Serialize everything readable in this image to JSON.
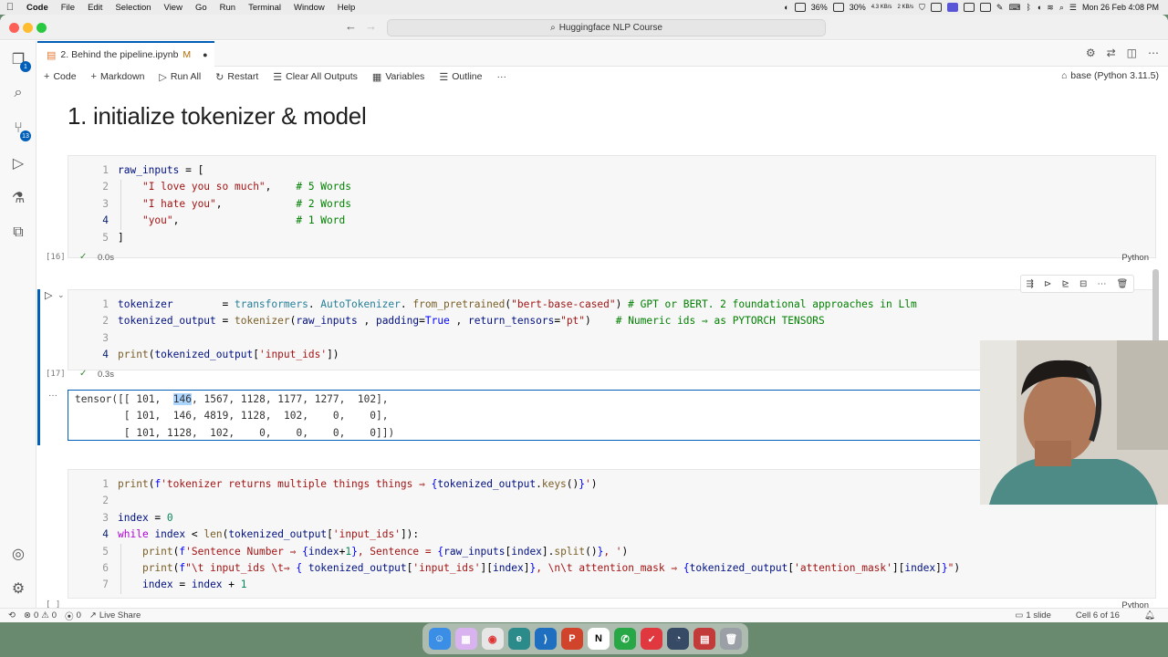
{
  "menubar": {
    "apple": "",
    "items": [
      "Code",
      "File",
      "Edit",
      "Selection",
      "View",
      "Go",
      "Run",
      "Terminal",
      "Window",
      "Help"
    ],
    "battery_pct": "36%",
    "cpu_pct": "30%",
    "net_up": "4.3 KB/s",
    "net_down": "2 KB/s",
    "datetime": "Mon 26 Feb  4:08 PM"
  },
  "titlebar": {
    "search": "Huggingface NLP Course"
  },
  "activity": {
    "explorer_badge": "1",
    "scm_badge": "13"
  },
  "tab": {
    "label": "2. Behind the pipeline.ipynb",
    "modified": "M"
  },
  "toolbar": {
    "code": "Code",
    "markdown": "Markdown",
    "run_all": "Run All",
    "restart": "Restart",
    "clear": "Clear All Outputs",
    "variables": "Variables",
    "outline": "Outline",
    "more": "···",
    "kernel": "base (Python 3.11.5)"
  },
  "heading": "1. initialize tokenizer & model",
  "cells": {
    "c1": {
      "count": "[16]",
      "time": "0.0s",
      "lang": "Python",
      "line_numbers": [
        "1",
        "2",
        "3",
        "4",
        "5"
      ]
    },
    "c2": {
      "count": "[17]",
      "time": "0.3s",
      "line_numbers": [
        "1",
        "2",
        "3",
        "4"
      ]
    },
    "c3": {
      "count": "[ ]",
      "lang": "Python",
      "line_numbers": [
        "1",
        "2",
        "3",
        "4",
        "5",
        "6",
        "7"
      ]
    }
  },
  "output": {
    "text": "tensor([[ 101,  146, 1567, 1128, 1177, 1277,  102],\n        [ 101,  146, 4819, 1128,  102,    0,    0],\n        [ 101, 1128,  102,    0,    0,    0,    0]])"
  },
  "statusbar": {
    "errors": "0",
    "warnings": "0",
    "ports": "0",
    "live_share": "Live Share",
    "slides": "1 slide",
    "cell_pos": "Cell 6 of 16"
  },
  "colors": {
    "accent": "#005fb8",
    "keyword": "#af00db",
    "string": "#a31515",
    "comment": "#008000"
  }
}
